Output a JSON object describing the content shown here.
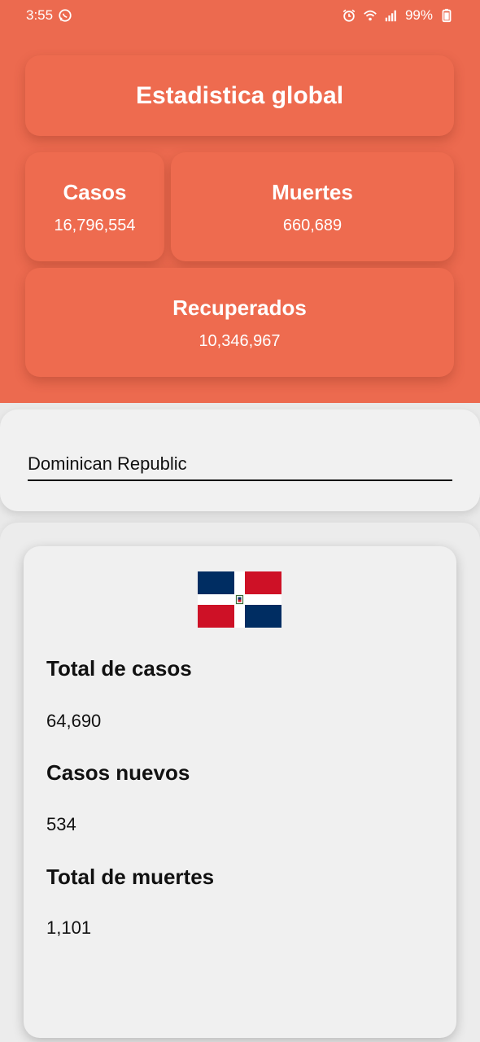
{
  "status_bar": {
    "time": "3:55",
    "battery": "99%",
    "icons": [
      "whatsapp-icon",
      "alarm-icon",
      "wifi-icon",
      "signal-icon",
      "battery-icon"
    ]
  },
  "global": {
    "title": "Estadistica global",
    "cases_label": "Casos",
    "cases_value": "16,796,554",
    "deaths_label": "Muertes",
    "deaths_value": "660,689",
    "recovered_label": "Recuperados",
    "recovered_value": "10,346,967"
  },
  "search": {
    "value": "Dominican Republic"
  },
  "country": {
    "flag_icon": "dominican-republic-flag",
    "total_cases_label": "Total de casos",
    "total_cases_value": "64,690",
    "new_cases_label": "Casos nuevos",
    "new_cases_value": "534",
    "total_deaths_label": "Total de muertes",
    "total_deaths_value": "1,101"
  },
  "colors": {
    "primary": "#ec6a4f",
    "card": "#ee6b4f",
    "flag_blue": "#002d62",
    "flag_red": "#ce1126"
  }
}
